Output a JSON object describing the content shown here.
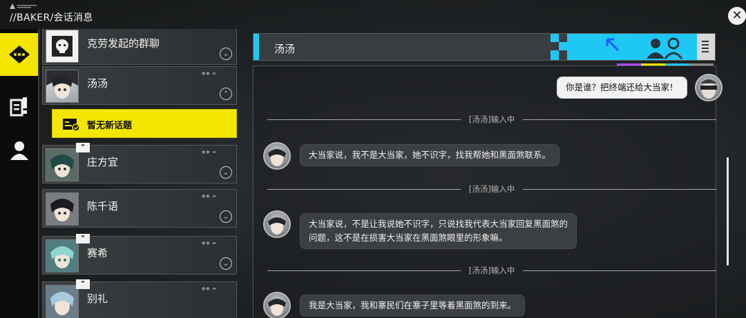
{
  "header": {
    "breadcrumb": "//BAKER/会话消息",
    "close_icon": "close-icon"
  },
  "rail": {
    "items": [
      {
        "name": "messages",
        "icon": "chat-bubble-icon",
        "active": true
      },
      {
        "name": "tasks",
        "icon": "document-alert-icon",
        "active": false
      },
      {
        "name": "contacts",
        "icon": "person-icon",
        "active": false
      }
    ]
  },
  "contacts": [
    {
      "name": "克劳发起的群聊",
      "expanded": false,
      "badge": ""
    },
    {
      "name": "汤汤",
      "expanded": true,
      "badge": ""
    },
    {
      "name": "庄方宜",
      "expanded": false,
      "badge": "\""
    },
    {
      "name": "陈千语",
      "expanded": false,
      "badge": ""
    },
    {
      "name": "赛希",
      "expanded": false,
      "badge": "\""
    },
    {
      "name": "别礼",
      "expanded": false,
      "badge": "\""
    }
  ],
  "topic": {
    "label": "暂无新话题"
  },
  "chat": {
    "title": "汤汤",
    "messages": [
      {
        "kind": "self",
        "text": "你是谁？把终端还给大当家！"
      },
      {
        "kind": "divider",
        "text": "[汤汤]输入中"
      },
      {
        "kind": "other",
        "lines": [
          "大当家说，我不是大当家，她不识字，找我帮她和黑面煞联系。"
        ]
      },
      {
        "kind": "divider",
        "text": "[汤汤]输入中"
      },
      {
        "kind": "other",
        "lines": [
          "大当家说，不是让我说她不识字，只说找我代表大当家回复黑面煞的",
          "问题，这不是在损害大当家在黑面煞眼里的形象嘛。"
        ]
      },
      {
        "kind": "divider",
        "text": "[汤汤]输入中"
      },
      {
        "kind": "other",
        "lines": [
          "我是大当家，我和寨民们在寨子里等着黑面煞的到来。"
        ]
      }
    ]
  },
  "colors": {
    "accent_yellow": "#f4e600",
    "accent_cyan": "#1fc8f4"
  }
}
